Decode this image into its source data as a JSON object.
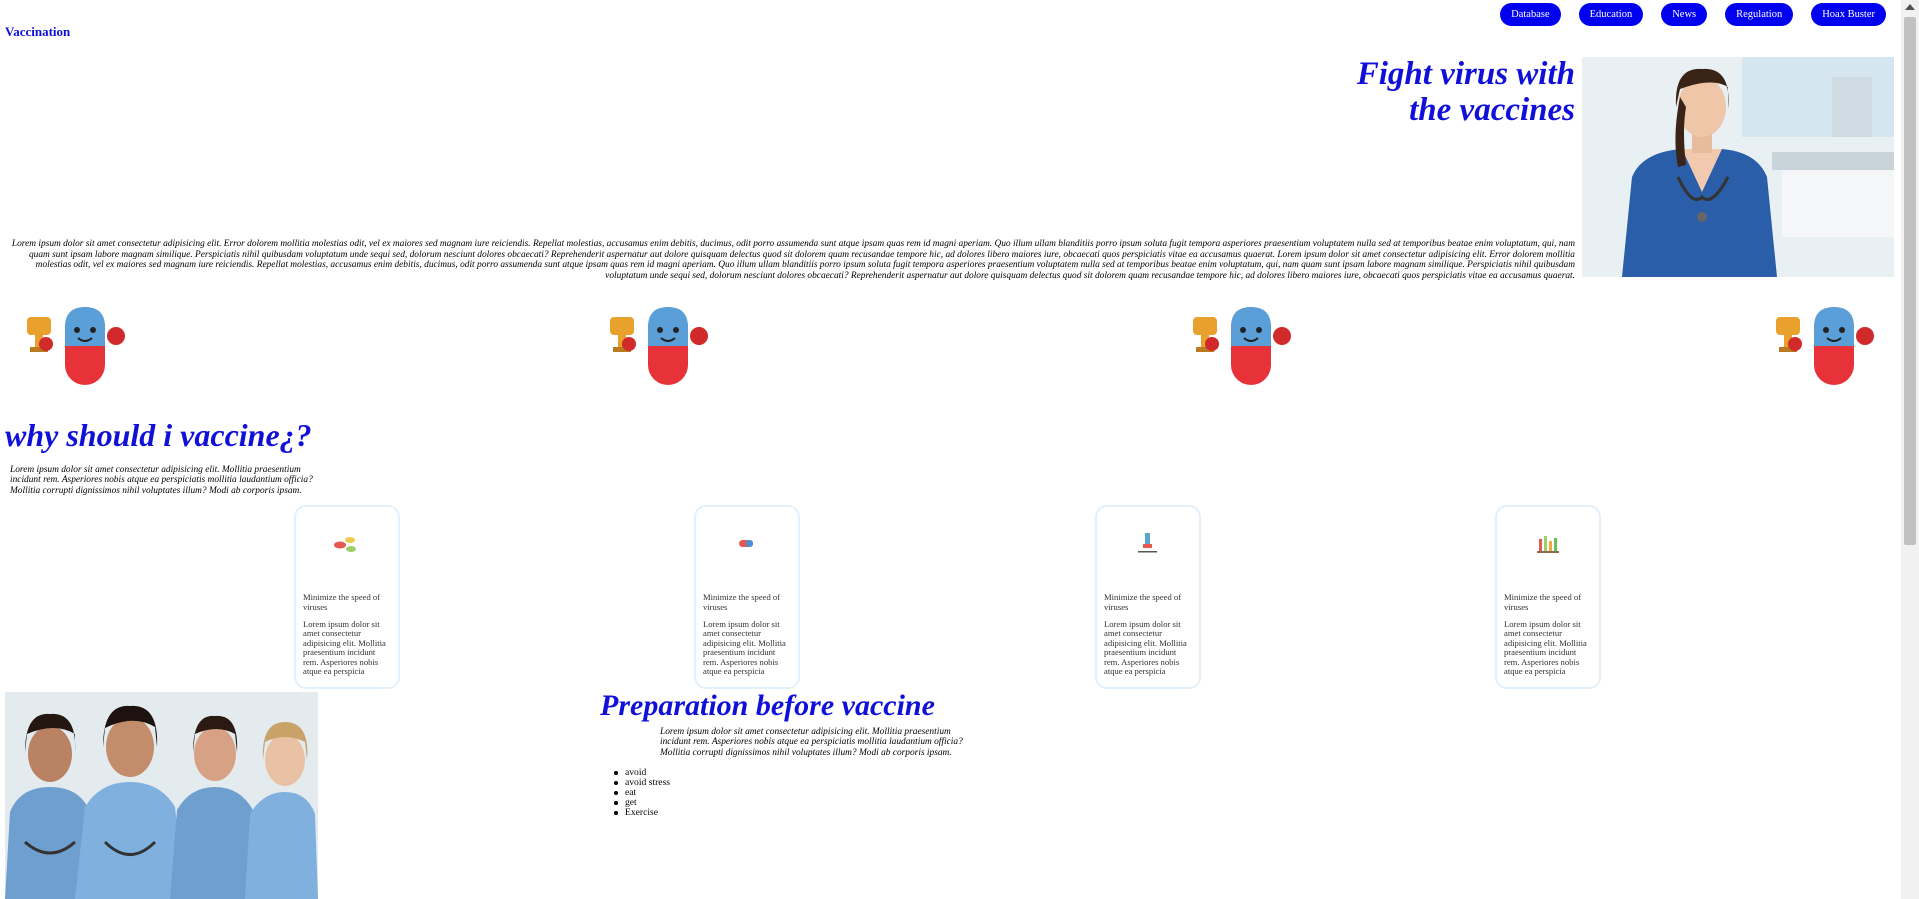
{
  "header": {
    "brand": "Vaccination",
    "nav": [
      {
        "label": "Database"
      },
      {
        "label": "Education"
      },
      {
        "label": "News"
      },
      {
        "label": "Regulation"
      },
      {
        "label": "Hoax Buster"
      }
    ]
  },
  "hero": {
    "title_line1": "Fight virus with",
    "title_line2": "the vaccines",
    "paragraph": "Lorem ipsum dolor sit amet consectetur adipisicing elit. Error dolorem mollitia molestias odit, vel ex maiores sed magnam iure reiciendis. Repellat molestias, accusamus enim debitis, ducimus, odit porro assumenda sunt atque ipsam quas rem id magni aperiam. Quo illum ullam blanditiis porro ipsum soluta fugit tempora asperiores praesentium voluptatem nulla sed at temporibus beatae enim voluptatum, qui, nam quam sunt ipsam labore magnam similique. Perspiciatis nihil quibusdam voluptatum unde sequi sed, dolorum nesciunt dolores obcaecati? Reprehenderit aspernatur aut dolore quisquam delectus quod sit dolorem quam recusandae tempore hic, ad dolores libero maiores iure, obcaecati quos perspiciatis vitae ea accusamus quaerat. Lorem ipsum dolor sit amet consectetur adipisicing elit. Error dolorem mollitia molestias odit, vel ex maiores sed magnam iure reiciendis. Repellat molestias, accusamus enim debitis, ducimus, odit porro assumenda sunt atque ipsam quas rem id magni aperiam. Quo illum ullam blanditiis porro ipsum soluta fugit tempora asperiores praesentium voluptatem nulla sed at temporibus beatae enim voluptatum, qui, nam quam sunt ipsam labore magnam similique. Perspiciatis nihil quibusdam voluptatum unde sequi sed, dolorum nesciunt dolores obcaecati? Reprehenderit aspernatur aut dolore quisquam delectus quod sit dolorem quam recusandae tempore hic, ad dolores libero maiores iure, obcaecati quos perspiciatis vitae ea accusamus quaerat."
  },
  "why": {
    "title": "why should i vaccine¿?",
    "paragraph": "Lorem ipsum dolor sit amet consectetur adipisicing elit. Mollitia praesentium incidunt rem. Asperiores nobis atque ea perspiciatis mollitia laudantium officia? Mollitia corrupti dignissimos nihil voluptates illum? Modi ab corporis ipsam."
  },
  "cards": [
    {
      "icon": "pills-icon",
      "heading": "Minimize the speed of viruses",
      "body": "Lorem ipsum dolor sit amet consectetur adipisicing elit. Mollitia praesentium incidunt rem. Asperiores nobis atque ea perspicia"
    },
    {
      "icon": "capsule-icon",
      "heading": "Minimize the speed of viruses",
      "body": "Lorem ipsum dolor sit amet consectetur adipisicing elit. Mollitia praesentium incidunt rem. Asperiores nobis atque ea perspicia"
    },
    {
      "icon": "syringe-icon",
      "heading": "Minimize the speed of viruses",
      "body": "Lorem ipsum dolor sit amet consectetur adipisicing elit. Mollitia praesentium incidunt rem. Asperiores nobis atque ea perspicia"
    },
    {
      "icon": "test-tubes-icon",
      "heading": "Minimize the speed of viruses",
      "body": "Lorem ipsum dolor sit amet consectetur adipisicing elit. Mollitia praesentium incidunt rem. Asperiores nobis atque ea perspicia"
    }
  ],
  "preparation": {
    "title": "Preparation before vaccine",
    "paragraph": "Lorem ipsum dolor sit amet consectetur adipisicing elit. Mollitia praesentium incidunt rem. Asperiores nobis atque ea perspiciatis mollitia laudantium officia? Mollitia corrupti dignissimos nihil voluptates illum? Modi ab corporis ipsam.",
    "items": [
      "avoid",
      "avoid stress",
      "eat",
      "get",
      "Exercise"
    ]
  },
  "colors": {
    "accent": "#1010d8",
    "nav_button": "#0000ee",
    "card_border": "#e3f0fb"
  }
}
